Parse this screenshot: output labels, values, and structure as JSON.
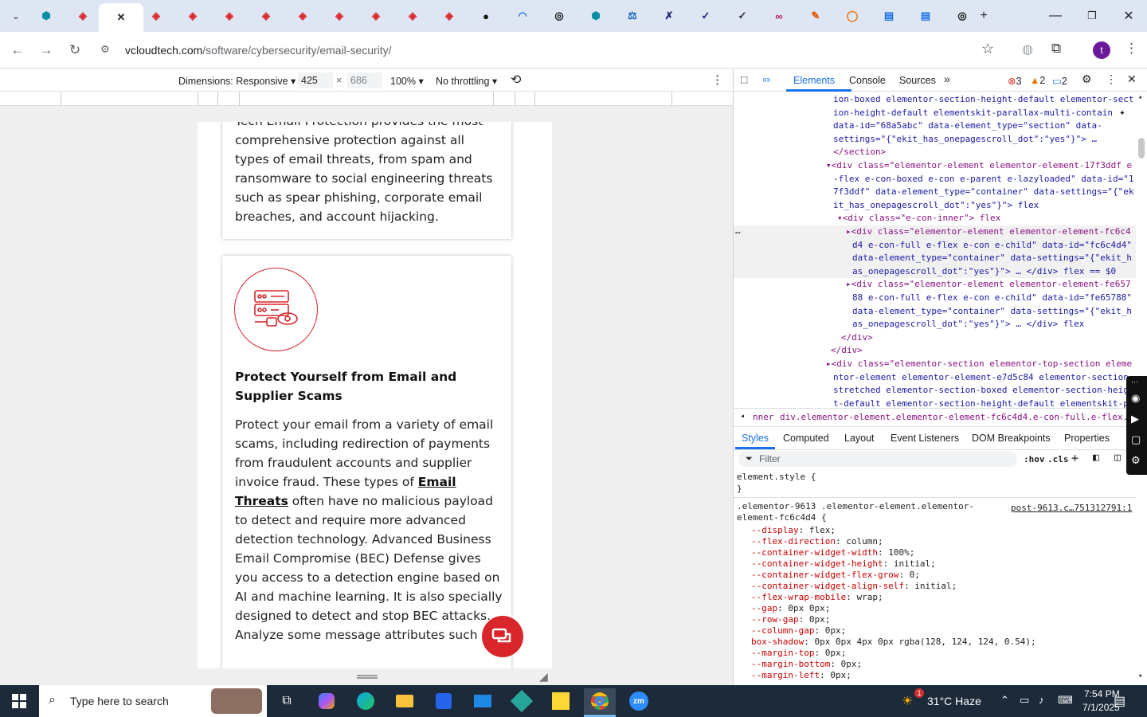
{
  "browser": {
    "tabs": [
      {
        "icon": "hexagon-tab-icon",
        "color": "#0b8ea4"
      },
      {
        "icon": "gift-tab-icon",
        "color": "#d9262a"
      },
      {
        "icon": "close-icon",
        "active": true
      },
      {
        "icon": "gift-tab-icon",
        "color": "#d9262a"
      },
      {
        "icon": "gift-tab-icon",
        "color": "#d9262a"
      },
      {
        "icon": "gift-tab-icon",
        "color": "#d9262a"
      },
      {
        "icon": "gift-tab-icon",
        "color": "#d9262a"
      },
      {
        "icon": "gift-tab-icon",
        "color": "#d9262a"
      },
      {
        "icon": "gift-tab-icon",
        "color": "#d9262a"
      },
      {
        "icon": "gift-tab-icon",
        "color": "#d9262a"
      },
      {
        "icon": "gift-tab-icon",
        "color": "#d9262a"
      },
      {
        "icon": "gift-tab-icon",
        "color": "#d9262a"
      },
      {
        "icon": "github-tab-icon",
        "color": "#111"
      },
      {
        "icon": "arc-tab-icon",
        "color": "#1a73e8"
      },
      {
        "icon": "openai-tab-icon",
        "color": "#111"
      },
      {
        "icon": "hexagon-tab-icon",
        "color": "#0b8ea4"
      },
      {
        "icon": "scale-tab-icon",
        "color": "#1565c0"
      },
      {
        "icon": "x-cross-tab-icon",
        "color": "#1a237e"
      },
      {
        "icon": "check-tab-icon",
        "color": "#1a237e"
      },
      {
        "icon": "check-tab-icon",
        "color": "#333"
      },
      {
        "icon": "link-tab-icon",
        "color": "#c2185b"
      },
      {
        "icon": "pen-tab-icon",
        "color": "#e65100"
      },
      {
        "icon": "circle-tab-icon",
        "color": "#ef6c00"
      },
      {
        "icon": "docs-tab-icon",
        "color": "#1a73e8"
      },
      {
        "icon": "docs-tab-icon",
        "color": "#1a73e8"
      },
      {
        "icon": "openai-tab-icon",
        "color": "#111"
      }
    ],
    "new_tab": "+",
    "url_host": "vcloudtech.com",
    "url_path": "/software/cybersecurity/email-security/",
    "profile_initial": "t"
  },
  "device_toolbar": {
    "dimensions_label": "Dimensions: Responsive",
    "width": "425",
    "times": "×",
    "height": "686",
    "zoom": "100%",
    "throttle": "No throttling"
  },
  "page": {
    "card1_text": "Tech Email Protection provides the most comprehensive protection against all types of email threats, from spam and ransomware to social engineering threats such as spear phishing, corporate email breaches, and account hijacking.",
    "card2_heading": "Protect Yourself from Email and Supplier Scams",
    "card2_text_a": "Protect your email from a variety of email scams, including redirection of payments from fraudulent accounts and supplier invoice fraud. These types of ",
    "card2_link": "Email Threats",
    "card2_text_b": " often have no malicious payload to detect and require more advanced detection technology. Advanced Business Email Compromise (BEC) Defense gives you access to a detection engine based on AI and machine learning. It is also specially designed to detect and stop BEC attacks. Analyze some message attributes such as:",
    "accent_color": "#d9262a"
  },
  "devtools": {
    "tabs": [
      "Elements",
      "Console",
      "Sources"
    ],
    "errors": "3",
    "warnings": "2",
    "info": "2",
    "dom_lines": [
      "ion-boxed elementor-section-height-default elementor-sect",
      "ion-height-default elementskit-parallax-multi-contain",
      "data-id=\"68a5abc\" data-element_type=\"section\" data-",
      "settings=\"{\"ekit_has_onepagescroll_dot\":\"yes\"}\"> …",
      "</section>",
      "▾<div class=\"elementor-element elementor-element-17f3ddf e",
      "-flex e-con-boxed e-con e-parent e-lazyloaded\" data-id=\"1",
      "7f3ddf\" data-element_type=\"container\" data-settings=\"{\"ek",
      "it_has_onepagescroll_dot\":\"yes\"}\"> flex",
      "▾<div class=\"e-con-inner\"> flex",
      "▸<div class=\"elementor-element elementor-element-fc6c4",
      "d4 e-con-full e-flex e-con e-child\" data-id=\"fc6c4d4\"",
      "data-element_type=\"container\" data-settings=\"{\"ekit_h",
      "as_onepagescroll_dot\":\"yes\"}\"> … </div> flex == $0",
      "▸<div class=\"elementor-element elementor-element-fe657",
      "88 e-con-full e-flex e-con e-child\" data-id=\"fe65788\"",
      "data-element_type=\"container\" data-settings=\"{\"ekit_h",
      "as_onepagescroll_dot\":\"yes\"}\"> … </div> flex",
      "</div>",
      "</div>",
      "▸<div class=\"elementor-section elementor-top-section eleme",
      "ntor-element elementor-element-e7d5c84 elementor-section-",
      "stretched elementor-section-boxed elementor-section-heig",
      "t-default elementor-section-height-default elementskit-p"
    ],
    "breadcrumb_prev": "nner",
    "breadcrumb": "div.elementor-element.elementor-element-fc6c4d4.e-con-full.e-flex.e-con.e-child",
    "panel_tabs": [
      "Styles",
      "Computed",
      "Layout",
      "Event Listeners",
      "DOM Breakpoints",
      "Properties"
    ],
    "filter_placeholder": "Filter",
    "hov": ":hov",
    "cls": ".cls",
    "element_style": "element.style {",
    "close_brace": "}",
    "selector_a": ".elementor-9613 .elementor-element.elementor-",
    "selector_b": "element-fc6c4d4 {",
    "source_link": "post-9613.c…751312791:1",
    "css_props": [
      [
        "--display",
        "flex;"
      ],
      [
        "--flex-direction",
        "column;"
      ],
      [
        "--container-widget-width",
        "100%;"
      ],
      [
        "--container-widget-height",
        "initial;"
      ],
      [
        "--container-widget-flex-grow",
        "0;"
      ],
      [
        "--container-widget-align-self",
        "initial;"
      ],
      [
        "--flex-wrap-mobile",
        "wrap;"
      ],
      [
        "--gap",
        "0px 0px;"
      ],
      [
        "--row-gap",
        "0px;"
      ],
      [
        "--column-gap",
        "0px;"
      ],
      [
        "box-shadow",
        "0px 0px 4px 0px rgba(128, 124, 124, 0.54);"
      ],
      [
        "--margin-top",
        "0px;"
      ],
      [
        "--margin-bottom",
        "0px;"
      ],
      [
        "--margin-left",
        "0px;"
      ]
    ]
  },
  "taskbar": {
    "search_placeholder": "Type here to search",
    "weather": "31°C Haze",
    "time": "7:54 PM",
    "date": "7/1/2025",
    "notification_count": "1"
  }
}
